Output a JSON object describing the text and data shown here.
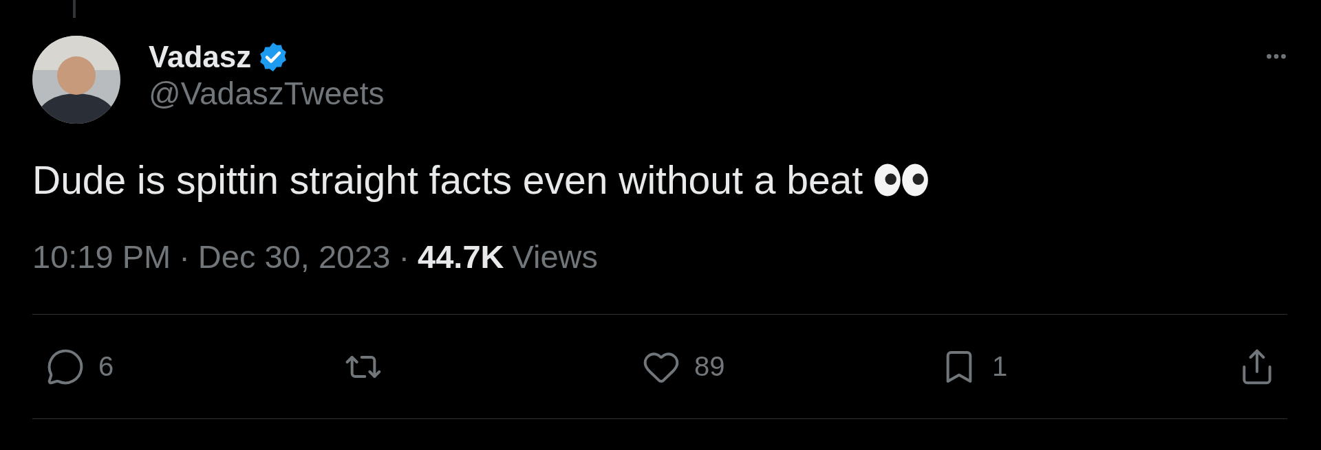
{
  "author": {
    "name": "Vadasz",
    "verified": true,
    "handle": "@VadaszTweets"
  },
  "tweet": {
    "text": "Dude is spittin straight facts even without a beat"
  },
  "meta": {
    "time": "10:19 PM",
    "separator": "·",
    "date": "Dec 30, 2023",
    "views": "44.7K",
    "views_label": "Views"
  },
  "actions": [
    {
      "kind": "reply",
      "count": "6"
    },
    {
      "kind": "retweet"
    },
    {
      "kind": "like",
      "count": "89"
    },
    {
      "kind": "bookmark",
      "count": "1"
    },
    {
      "kind": "share"
    }
  ]
}
